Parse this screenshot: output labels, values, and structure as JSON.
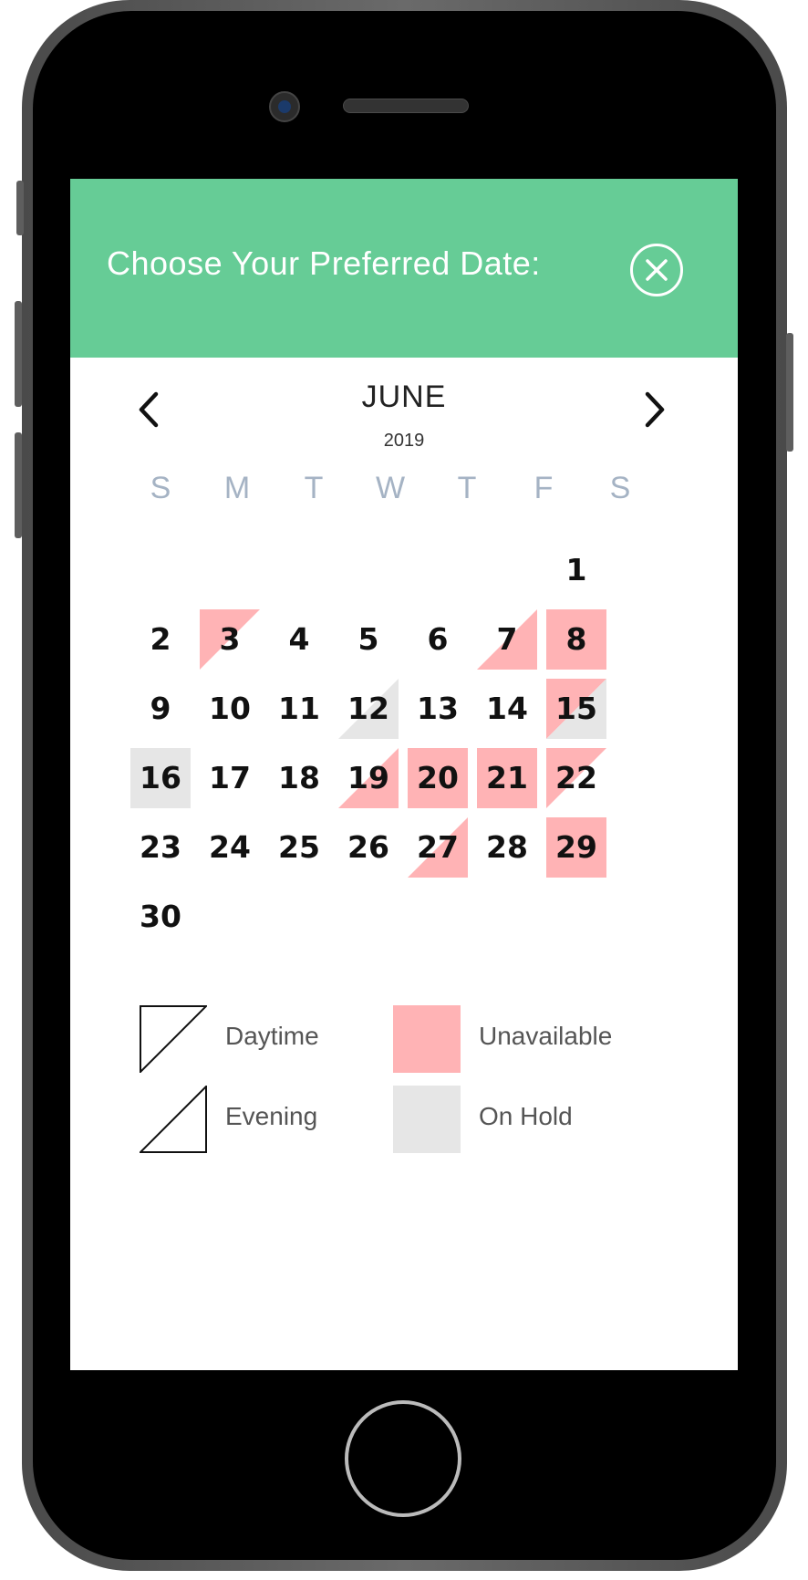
{
  "header": {
    "title": "Choose Your Preferred Date:"
  },
  "calendar": {
    "month": "JUNE",
    "year": "2019",
    "weekdays": [
      "S",
      "M",
      "T",
      "W",
      "T",
      "F",
      "S"
    ],
    "first_weekday_index": 6,
    "days": [
      {
        "d": "1",
        "status": "available"
      },
      {
        "d": "2",
        "status": "available"
      },
      {
        "d": "3",
        "status": "daytime_booked"
      },
      {
        "d": "4",
        "status": "available"
      },
      {
        "d": "5",
        "status": "available"
      },
      {
        "d": "6",
        "status": "available"
      },
      {
        "d": "7",
        "status": "evening_booked"
      },
      {
        "d": "8",
        "status": "unavailable"
      },
      {
        "d": "9",
        "status": "available"
      },
      {
        "d": "10",
        "status": "available"
      },
      {
        "d": "11",
        "status": "available"
      },
      {
        "d": "12",
        "status": "evening_on_hold"
      },
      {
        "d": "13",
        "status": "available"
      },
      {
        "d": "14",
        "status": "available"
      },
      {
        "d": "15",
        "status": "daytime_booked_evening_on_hold"
      },
      {
        "d": "16",
        "status": "on_hold"
      },
      {
        "d": "17",
        "status": "available"
      },
      {
        "d": "18",
        "status": "available"
      },
      {
        "d": "19",
        "status": "evening_booked"
      },
      {
        "d": "20",
        "status": "unavailable"
      },
      {
        "d": "21",
        "status": "unavailable"
      },
      {
        "d": "22",
        "status": "daytime_booked"
      },
      {
        "d": "23",
        "status": "available"
      },
      {
        "d": "24",
        "status": "available"
      },
      {
        "d": "25",
        "status": "available"
      },
      {
        "d": "26",
        "status": "available"
      },
      {
        "d": "27",
        "status": "evening_booked"
      },
      {
        "d": "28",
        "status": "available"
      },
      {
        "d": "29",
        "status": "unavailable"
      },
      {
        "d": "30",
        "status": "available"
      }
    ]
  },
  "legend": {
    "daytime": "Daytime",
    "evening": "Evening",
    "unavailable": "Unavailable",
    "on_hold": "On Hold"
  },
  "colors": {
    "header": "#66cc96",
    "unavailable": "#ffb3b5",
    "on_hold": "#e6e6e6",
    "weekday": "#a5b3c4"
  }
}
